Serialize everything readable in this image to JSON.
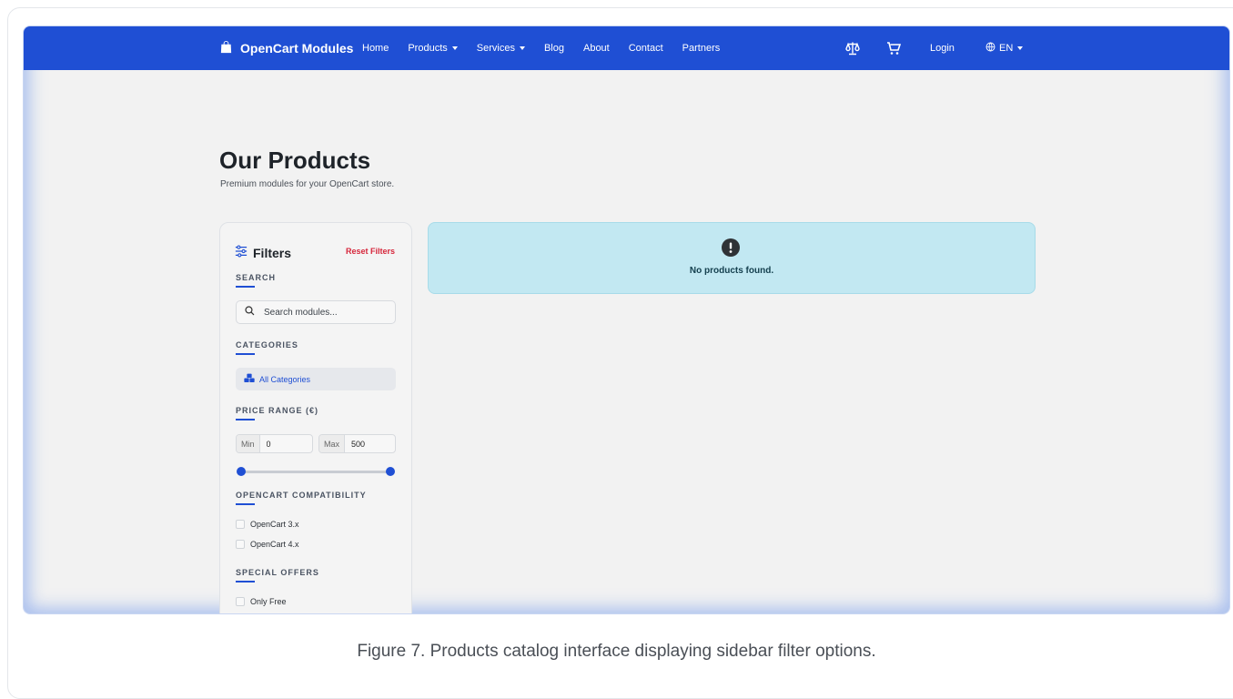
{
  "navbar": {
    "brand": "OpenCart Modules",
    "links": [
      {
        "label": "Home"
      },
      {
        "label": "Products"
      },
      {
        "label": "Services"
      },
      {
        "label": "Blog"
      },
      {
        "label": "About"
      },
      {
        "label": "Contact"
      },
      {
        "label": "Partners"
      }
    ],
    "compare_icon": "scale-balance-icon",
    "cart_icon": "cart-icon",
    "login": "Login",
    "language": "EN",
    "accent_color": "#1f4fd4"
  },
  "main": {
    "title": "Our Products",
    "subtitle": "Premium modules for your OpenCart store."
  },
  "filters": {
    "title": "Filters",
    "reset": "Reset Filters",
    "search_label": "SEARCH",
    "search_placeholder": "Search modules...",
    "categories_label": "CATEGORIES",
    "all_categories": "All Categories",
    "price_label": "PRICE RANGE (€)",
    "min_label": "Min",
    "min_value": "0",
    "max_label": "Max",
    "max_value": "500",
    "compat_label": "OPENCART COMPATIBILITY",
    "compat_options": [
      "OpenCart 3.x",
      "OpenCart 4.x"
    ],
    "offers_label": "SPECIAL OFFERS",
    "offers_options": [
      "Only Free"
    ]
  },
  "alert": {
    "icon": "exclamation-circle-icon",
    "message": "No products found.",
    "bg_color": "#c2e8f2"
  },
  "caption": "Figure 7. Products catalog interface displaying sidebar filter options."
}
